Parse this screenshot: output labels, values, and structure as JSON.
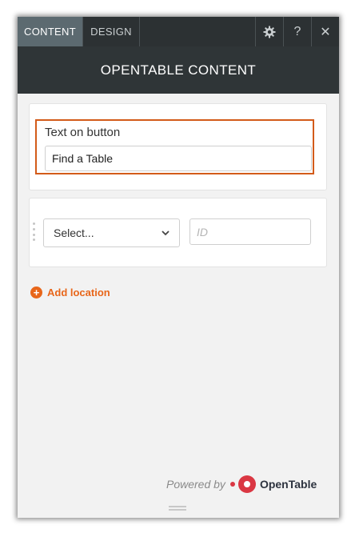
{
  "tabs": [
    {
      "label": "CONTENT",
      "active": true
    },
    {
      "label": "DESIGN",
      "active": false
    }
  ],
  "toolbar": {
    "settings_icon": "gear-icon",
    "help_label": "?",
    "close_label": "✕"
  },
  "header": {
    "title": "OPENTABLE CONTENT"
  },
  "button_text": {
    "label": "Text on button",
    "value": "Find a Table"
  },
  "location": {
    "select_value": "Select...",
    "id_placeholder": "ID"
  },
  "add_location": {
    "label": "Add location"
  },
  "footer": {
    "powered_by": "Powered by",
    "brand": "OpenTable",
    "brand_mark": "·"
  },
  "colors": {
    "accent": "#e8661a",
    "highlight_border": "#d35b1a",
    "topbar": "#2c3133",
    "brand_red": "#da3743"
  }
}
